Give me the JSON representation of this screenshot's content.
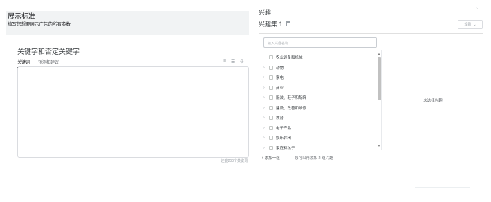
{
  "left": {
    "title": "展示标准",
    "subtitle": "填写您想要展示广告的所有参数",
    "card_title": "关键字和否定关键字",
    "tabs": [
      "关键词",
      "预测和建议"
    ],
    "tools": [
      "≡",
      "☰",
      "⊘"
    ],
    "counter": "还能200个关键词"
  },
  "right": {
    "heading": "兴趣",
    "collapse": "^",
    "set_title": "兴趣集 1",
    "rule_button": "规则",
    "search_placeholder": "输入兴趣名称",
    "categories": [
      {
        "label": "农业设备和机械",
        "expandable": false
      },
      {
        "label": "动物",
        "expandable": true
      },
      {
        "label": "家电",
        "expandable": true
      },
      {
        "label": "商业",
        "expandable": true
      },
      {
        "label": "服装、鞋子和配饰",
        "expandable": true
      },
      {
        "label": "建设、改善和维修",
        "expandable": true
      },
      {
        "label": "教育",
        "expandable": true
      },
      {
        "label": "电子产品",
        "expandable": true
      },
      {
        "label": "娱乐休闲",
        "expandable": true
      },
      {
        "label": "家庭和孩子",
        "expandable": true
      }
    ],
    "empty_selection": "未选择兴趣",
    "add_group": "+ 添加一组",
    "hint": "您可以再添加 2 组兴趣"
  },
  "colors": {
    "accent": "#202124",
    "panel_bg": "#f1f3f4",
    "border": "#dadce0"
  }
}
